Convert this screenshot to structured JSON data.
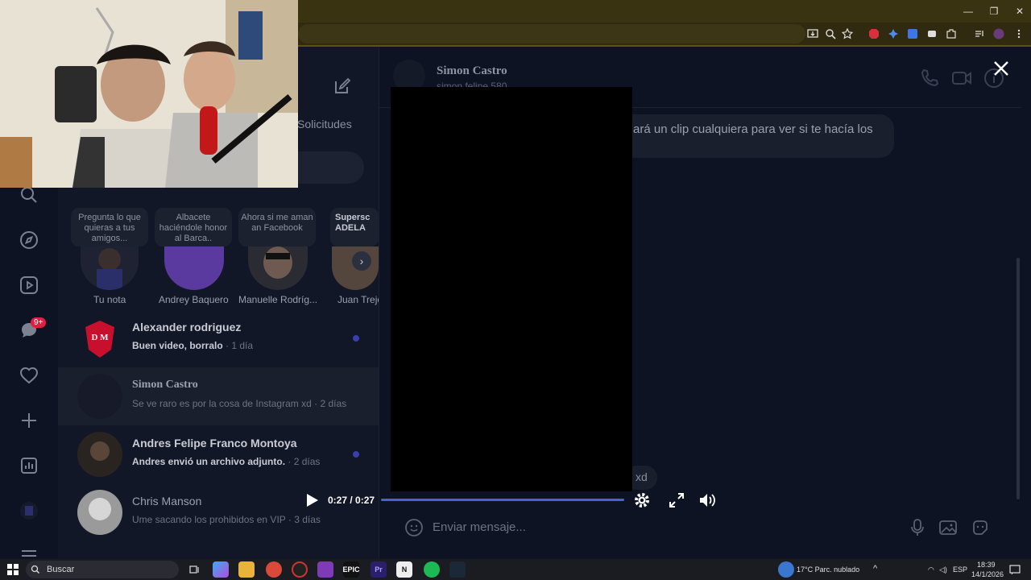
{
  "browser": {
    "window_controls": {
      "minimize": "—",
      "restore": "❐",
      "close": "✕"
    }
  },
  "list": {
    "solicitudes_label": "Solicitudes",
    "notes": [
      {
        "bubble": "Pregunta lo que quieras a tus amigos...",
        "name": "Tu nota"
      },
      {
        "bubble": "Albacete haciéndole honor al Barca..",
        "name": "Andrey Baquero"
      },
      {
        "bubble": "Ahora si me aman an Facebook",
        "name": "Manuelle Rodríg..."
      },
      {
        "bubble": "Supersc ADELA",
        "name": "Juan Trejo"
      }
    ],
    "conversations": [
      {
        "name": "Alexander rodriguez",
        "preview": "Buen video, borralo",
        "time": "· 1 día",
        "unread": true
      },
      {
        "name": "Simon Castro",
        "preview": "Se ve raro es por la cosa de Instagram xd",
        "time": "· 2 días",
        "unread": false
      },
      {
        "name": "Andres Felipe Franco Montoya",
        "preview": "Andres envió un archivo adjunto.",
        "time": "· 2 días",
        "unread": true
      },
      {
        "name": "Chris Manson",
        "preview": "Ume sacando los prohibidos en VIP",
        "time": "· 3 días",
        "unread": false
      }
    ],
    "badge_count": "9+"
  },
  "chat": {
    "header_name": "Simon Castro",
    "header_handle": "simon.felipe.580",
    "message_text": "ará un clip cualquiera para ver si te hacía los",
    "xd_text": "xd",
    "composer_placeholder": "Enviar mensaje..."
  },
  "video": {
    "time_display": "0:27 / 0:27",
    "progress": 1.0
  },
  "taskbar": {
    "search_label": "Buscar",
    "weather": "17°C  Parc. nublado",
    "language": "ESP",
    "time": "18:39",
    "date": "14/1/2026"
  }
}
